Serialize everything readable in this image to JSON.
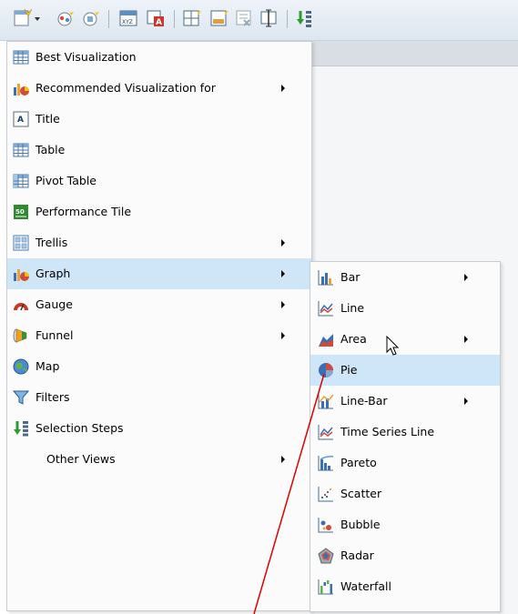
{
  "toolbar": {
    "buttons": [
      {
        "name": "new-view-dropdown",
        "icon": "new-view-icon"
      },
      {
        "name": "compound-view-button",
        "icon": "compound-view-icon"
      },
      {
        "name": "analysis-button",
        "icon": "analysis-icon"
      },
      {
        "name": "calculator-button",
        "icon": "calculator-icon"
      },
      {
        "name": "format-button",
        "icon": "format-icon"
      },
      {
        "name": "new-dashboard-button",
        "icon": "new-dashboard-icon"
      },
      {
        "name": "add-view-button",
        "icon": "add-view-icon"
      },
      {
        "name": "remove-view-button",
        "icon": "remove-view-icon"
      },
      {
        "name": "properties-button",
        "icon": "properties-icon"
      },
      {
        "name": "selection-steps-button",
        "icon": "selection-steps-icon"
      }
    ]
  },
  "main_menu": {
    "items": [
      {
        "label": "Best Visualization",
        "icon": "table-icon",
        "submenu": false
      },
      {
        "label": "Recommended Visualization for",
        "icon": "graph-icon",
        "submenu": true
      },
      {
        "label": "Title",
        "icon": "title-icon",
        "submenu": false
      },
      {
        "label": "Table",
        "icon": "table-icon",
        "submenu": false
      },
      {
        "label": "Pivot Table",
        "icon": "pivot-table-icon",
        "submenu": false
      },
      {
        "label": "Performance Tile",
        "icon": "performance-tile-icon",
        "submenu": false
      },
      {
        "label": "Trellis",
        "icon": "trellis-icon",
        "submenu": true
      },
      {
        "label": "Graph",
        "icon": "graph-icon",
        "submenu": true,
        "selected": true
      },
      {
        "label": "Gauge",
        "icon": "gauge-icon",
        "submenu": true
      },
      {
        "label": "Funnel",
        "icon": "funnel-icon",
        "submenu": true
      },
      {
        "label": "Map",
        "icon": "map-icon",
        "submenu": false
      },
      {
        "label": "Filters",
        "icon": "filter-icon",
        "submenu": false
      },
      {
        "label": "Selection Steps",
        "icon": "selection-steps-icon",
        "submenu": false
      },
      {
        "label": "Other Views",
        "icon": "",
        "submenu": true
      }
    ]
  },
  "graph_submenu": {
    "items": [
      {
        "label": "Bar",
        "icon": "bar-chart-icon",
        "submenu": true
      },
      {
        "label": "Line",
        "icon": "line-chart-icon",
        "submenu": false
      },
      {
        "label": "Area",
        "icon": "area-chart-icon",
        "submenu": true
      },
      {
        "label": "Pie",
        "icon": "pie-chart-icon",
        "submenu": false,
        "selected": true
      },
      {
        "label": "Line-Bar",
        "icon": "line-bar-chart-icon",
        "submenu": true
      },
      {
        "label": "Time Series Line",
        "icon": "time-series-icon",
        "submenu": false
      },
      {
        "label": "Pareto",
        "icon": "pareto-chart-icon",
        "submenu": false
      },
      {
        "label": "Scatter",
        "icon": "scatter-chart-icon",
        "submenu": false
      },
      {
        "label": "Bubble",
        "icon": "bubble-chart-icon",
        "submenu": false
      },
      {
        "label": "Radar",
        "icon": "radar-chart-icon",
        "submenu": false
      },
      {
        "label": "Waterfall",
        "icon": "waterfall-chart-icon",
        "submenu": false
      }
    ]
  },
  "colors": {
    "selected_bg": "#cfe6f8",
    "menu_bg": "#fbfbfb",
    "annotation_line": "#e00000"
  }
}
